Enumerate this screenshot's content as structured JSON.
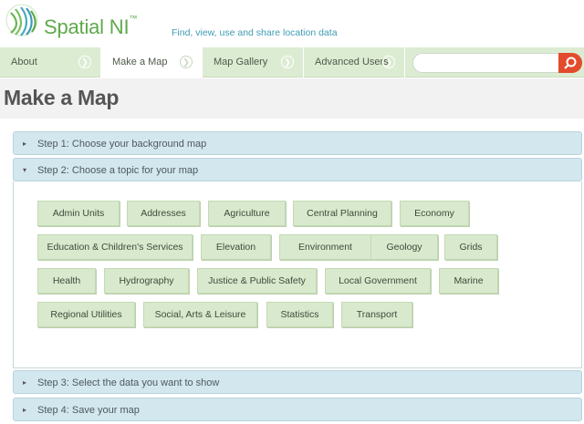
{
  "header": {
    "brand": "Spatial NI",
    "brand_mark": "™",
    "tagline": "Find, view, use and share location data"
  },
  "nav": {
    "items": [
      {
        "label": "About"
      },
      {
        "label": "Make a Map"
      },
      {
        "label": "Map Gallery"
      },
      {
        "label": "Advanced Users"
      }
    ],
    "active": "Make a Map",
    "search_placeholder": ""
  },
  "page": {
    "title": "Make a Map"
  },
  "steps": [
    {
      "label": "Step 1: Choose your background map",
      "expanded": false
    },
    {
      "label": "Step 2: Choose a topic for your map",
      "expanded": true
    },
    {
      "label": "Step 3: Select the data you want to show",
      "expanded": false
    },
    {
      "label": "Step 4: Save your map",
      "expanded": false
    }
  ],
  "topics": [
    "Admin Units",
    "Addresses",
    "Agriculture",
    "Central Planning",
    "Economy",
    "Education & Children's Services",
    "Elevation",
    "Environment",
    "Geology",
    "Grids",
    "Health",
    "Hydrography",
    "Justice & Public Safety",
    "Local Government",
    "Marine",
    "Regional Utilities",
    "Social, Arts & Leisure",
    "Statistics",
    "Transport"
  ],
  "colors": {
    "brand_green": "#5fa94c",
    "tagline_blue": "#3e9bb4",
    "nav_bg": "#dcecd3",
    "accordion_bg": "#d3e7ee",
    "topic_bg": "#d8e9cd",
    "search_button": "#e24b2c"
  }
}
